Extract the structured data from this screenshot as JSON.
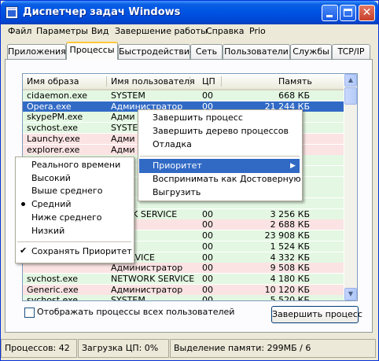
{
  "window": {
    "title": "Диспетчер задач Windows"
  },
  "menu": [
    "Файл",
    "Параметры",
    "Вид",
    "Завершение работы",
    "Справка",
    "Prio"
  ],
  "tabs": [
    "Приложения",
    "Процессы",
    "Быстродействие",
    "Сеть",
    "Пользователи",
    "Службы",
    "TCP/IP"
  ],
  "list": {
    "headers": [
      "Имя образа",
      "Имя пользователя",
      "ЦП",
      "Память"
    ],
    "rows": [
      {
        "name": "cidaemon.exe",
        "user": "SYSTEM",
        "cpu": "00",
        "mem": "668 КБ",
        "color": "#e3f7e2"
      },
      {
        "name": "Opera.exe",
        "user": "Администратор",
        "cpu": "00",
        "mem": "21 244 КБ",
        "color": "#316ac5"
      },
      {
        "name": "skypePM.exe",
        "user": "Адми",
        "cpu": "",
        "mem": "",
        "color": "#e3f7e2"
      },
      {
        "name": "svchost.exe",
        "user": "SYSTEM",
        "cpu": "",
        "mem": "",
        "color": "#e3f7e2"
      },
      {
        "name": "Launchy.exe",
        "user": "Адми",
        "cpu": "",
        "mem": "",
        "color": "#fbe3e3"
      },
      {
        "name": "explorer.exe",
        "user": "Адми",
        "cpu": "",
        "mem": "",
        "color": "#fbe3e3"
      },
      {
        "name": "",
        "user": "",
        "cpu": "",
        "mem": "",
        "color": "#e3f7e2"
      },
      {
        "name": "",
        "user": "",
        "cpu": "",
        "mem": "",
        "color": "#e3f7e2"
      },
      {
        "name": "",
        "user": "",
        "cpu": "",
        "mem": "",
        "color": "#e3f7e2"
      },
      {
        "name": "",
        "user": "",
        "cpu": "",
        "mem": "",
        "color": "#e3f7e2"
      },
      {
        "name": "",
        "user": "",
        "cpu": "",
        "mem": "",
        "color": "#e3f7e2"
      },
      {
        "name": "",
        "user": "WORK SERVICE",
        "cpu": "00",
        "mem": "3 256 КБ",
        "color": "#e3f7e2"
      },
      {
        "name": "",
        "user": "M",
        "cpu": "00",
        "mem": "2 688 КБ",
        "color": "#fbe3e3"
      },
      {
        "name": "",
        "user": "M",
        "cpu": "00",
        "mem": "23 908 КБ",
        "color": "#e3f7e2"
      },
      {
        "name": "",
        "user": "M",
        "cpu": "00",
        "mem": "1 524 КБ",
        "color": "#e3f7e2"
      },
      {
        "name": "",
        "user": "L SERVICE",
        "cpu": "00",
        "mem": "4 332 КБ",
        "color": "#e3f7e2"
      },
      {
        "name": "",
        "user": "Администратор",
        "cpu": "00",
        "mem": "9 508 КБ",
        "color": "#fbe3e3"
      },
      {
        "name": "svchost.exe",
        "user": "NETWORK SERVICE",
        "cpu": "00",
        "mem": "4 180 КБ",
        "color": "#e3f7e2"
      },
      {
        "name": "Generic.exe",
        "user": "Администратор",
        "cpu": "00",
        "mem": "10 120 КБ",
        "color": "#fbe3e3"
      },
      {
        "name": "svchost.exe",
        "user": "SYSTEM",
        "cpu": "00",
        "mem": "5 520 КБ",
        "color": "#e3f7e2"
      }
    ]
  },
  "context_menu": {
    "items": [
      "Завершить процесс",
      "Завершить дерево процессов",
      "Отладка",
      "Приоритет",
      "Воспринимать как Достоверную",
      "Выгрузить"
    ],
    "highlighted": "Приоритет"
  },
  "priority_menu": {
    "items": [
      "Реального времени",
      "Высокий",
      "Выше среднего",
      "Средний",
      "Ниже среднего",
      "Низкий"
    ],
    "selected": "Средний",
    "save_label": "Сохранять Приоритет"
  },
  "show_all_label": "Отображать процессы всех пользователей",
  "end_process_label": "Завершить процесс",
  "status": {
    "processes": "Процессов: 42",
    "cpu": "Загрузка ЦП: 0%",
    "memory": "Выделение памяти: 299МБ / 6"
  }
}
